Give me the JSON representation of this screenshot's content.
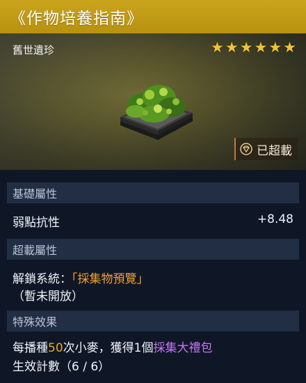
{
  "title": "《作物培養指南》",
  "hero": {
    "rarity": "舊世遺珍",
    "stars": [
      "★",
      "★",
      "★",
      "★",
      "★",
      "★"
    ],
    "badge_label": "已超載"
  },
  "sections": {
    "base": {
      "header": "基礎屬性",
      "stat_name": "弱點抗性",
      "stat_value": "+8.48"
    },
    "overload": {
      "header": "超載屬性",
      "unlock_prefix": "解鎖系統：",
      "unlock_target": "「採集物預覽」",
      "unlock_note": "（暫未開放）"
    },
    "special": {
      "header": "特殊效果",
      "line1_a": "每播種",
      "line1_num": "50",
      "line1_b": "次小麥，獲得1個",
      "line1_reward": "採集大禮包",
      "line2": "生效計數（6 / 6）"
    }
  },
  "colors": {
    "title_bar": "#c9a41c",
    "star": "#f2c233",
    "highlight_orange": "#f0a035",
    "highlight_purple": "#c674f5"
  }
}
